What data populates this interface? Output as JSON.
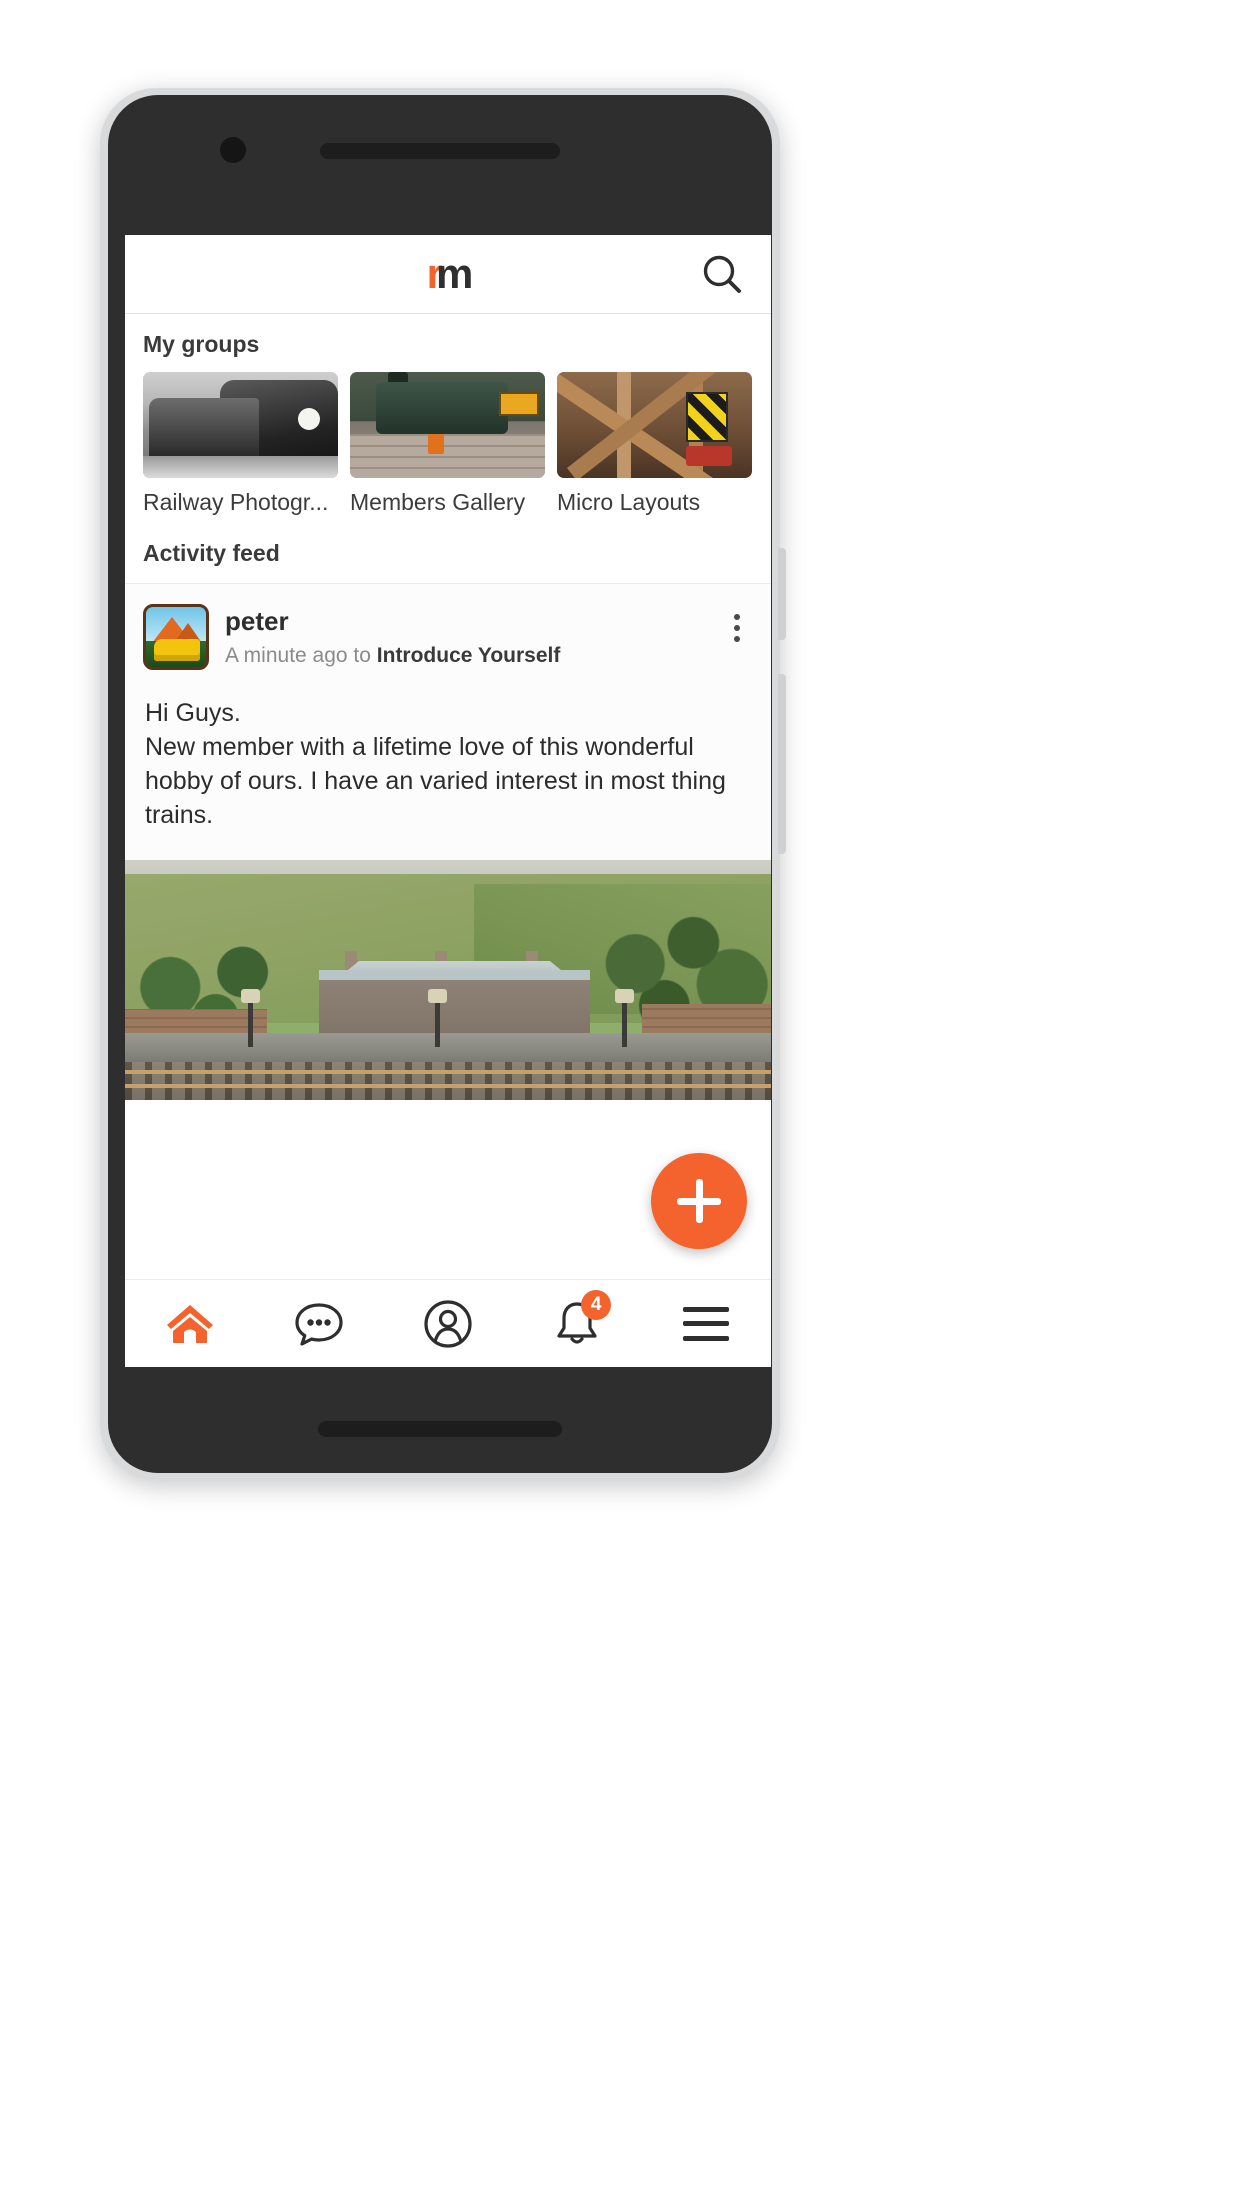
{
  "app": {
    "logo_r": "r",
    "logo_m": "m",
    "search_icon": "search-icon"
  },
  "groups_section": {
    "title": "My groups",
    "items": [
      {
        "label": "Railway Photogr...",
        "thumb": "railway-photography-thumb"
      },
      {
        "label": "Members Gallery",
        "thumb": "members-gallery-thumb"
      },
      {
        "label": "Micro Layouts",
        "thumb": "micro-layouts-thumb"
      }
    ]
  },
  "feed_section": {
    "title": "Activity feed",
    "post": {
      "author": "peter",
      "time_prefix": "A minute ago to ",
      "group": "Introduce Yourself",
      "body": "Hi Guys.\nNew member with a lifetime love of this wonderful hobby of ours. I have an varied interest in most thing trains.",
      "menu_icon": "more-vertical-icon",
      "avatar_icon": "user-avatar",
      "photo_alt": "model-railway-station-photo"
    }
  },
  "fab": {
    "label": "+",
    "icon": "plus-icon"
  },
  "bottom_nav": {
    "items": [
      {
        "name": "home",
        "icon": "home-icon",
        "active": true,
        "badge": ""
      },
      {
        "name": "messages",
        "icon": "chat-bubble-icon",
        "active": false,
        "badge": ""
      },
      {
        "name": "profile",
        "icon": "user-circle-icon",
        "active": false,
        "badge": ""
      },
      {
        "name": "notifications",
        "icon": "bell-icon",
        "active": false,
        "badge": "4"
      },
      {
        "name": "menu",
        "icon": "hamburger-menu-icon",
        "active": false,
        "badge": ""
      }
    ],
    "notification_count": "4"
  },
  "colors": {
    "accent": "#f4632e",
    "text_dark": "#2e2e2e",
    "text_muted": "#8b8b8b"
  }
}
